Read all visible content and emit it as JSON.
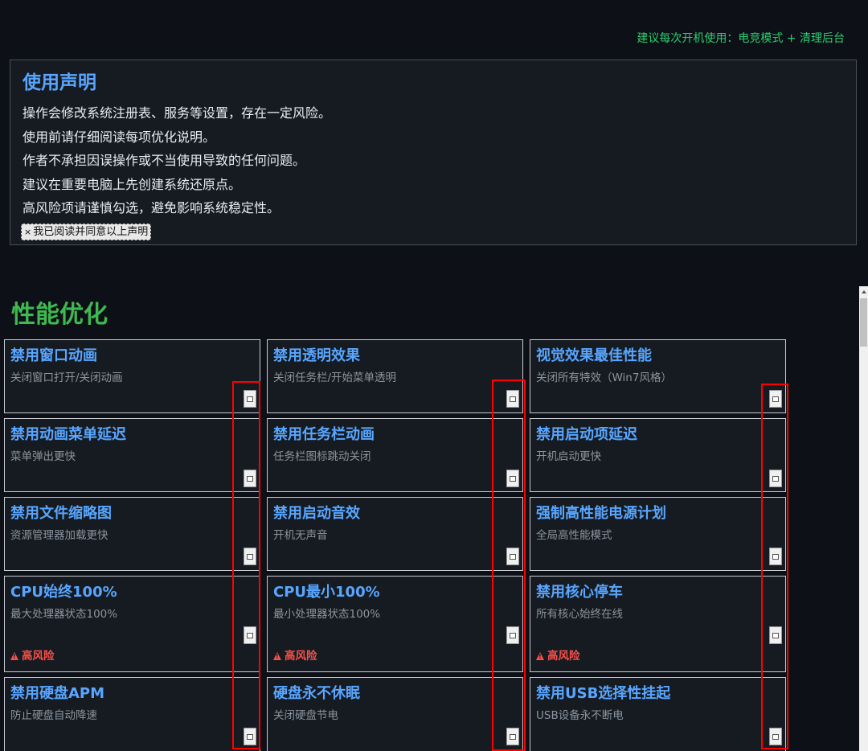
{
  "tip": "建议每次开机使用：电竞模式 + 清理后台",
  "disclaimer": {
    "title": "使用声明",
    "lines": [
      "操作会修改系统注册表、服务等设置，存在一定风险。",
      "使用前请仔细阅读每项优化说明。",
      "作者不承担因误操作或不当使用导致的任何问题。",
      "建议在重要电脑上先创建系统还原点。",
      "高风险项请谨慎勾选，避免影响系统稳定性。"
    ],
    "agree_mark": "×",
    "agree_label": "我已阅读并同意以上声明"
  },
  "section": {
    "title": "性能优化",
    "risk_label": "高风险",
    "items": [
      {
        "title": "禁用窗口动画",
        "desc": "关闭窗口打开/关闭动画",
        "risk": false
      },
      {
        "title": "禁用透明效果",
        "desc": "关闭任务栏/开始菜单透明",
        "risk": false
      },
      {
        "title": "视觉效果最佳性能",
        "desc": "关闭所有特效（Win7风格）",
        "risk": false
      },
      {
        "title": "禁用动画菜单延迟",
        "desc": "菜单弹出更快",
        "risk": false
      },
      {
        "title": "禁用任务栏动画",
        "desc": "任务栏图标跳动关闭",
        "risk": false
      },
      {
        "title": "禁用启动项延迟",
        "desc": "开机启动更快",
        "risk": false
      },
      {
        "title": "禁用文件缩略图",
        "desc": "资源管理器加载更快",
        "risk": false
      },
      {
        "title": "禁用启动音效",
        "desc": "开机无声音",
        "risk": false
      },
      {
        "title": "强制高性能电源计划",
        "desc": "全局高性能模式",
        "risk": false
      },
      {
        "title": "CPU始终100%",
        "desc": "最大处理器状态100%",
        "risk": true
      },
      {
        "title": "CPU最小100%",
        "desc": "最小处理器状态100%",
        "risk": true
      },
      {
        "title": "禁用核心停车",
        "desc": "所有核心始终在线",
        "risk": true
      },
      {
        "title": "禁用硬盘APM",
        "desc": "防止硬盘自动降速",
        "risk": false
      },
      {
        "title": "硬盘永不休眠",
        "desc": "关闭硬盘节电",
        "risk": false
      },
      {
        "title": "禁用USB选择性挂起",
        "desc": "USB设备永不断电",
        "risk": false
      }
    ]
  },
  "colors": {
    "background": "#0d1117",
    "card_bg": "#161b22",
    "accent_blue": "#58a6ff",
    "accent_green": "#3fb950",
    "tip_green": "#2ecc71",
    "risk_red": "#f85149",
    "highlight_red": "#ff0000"
  }
}
